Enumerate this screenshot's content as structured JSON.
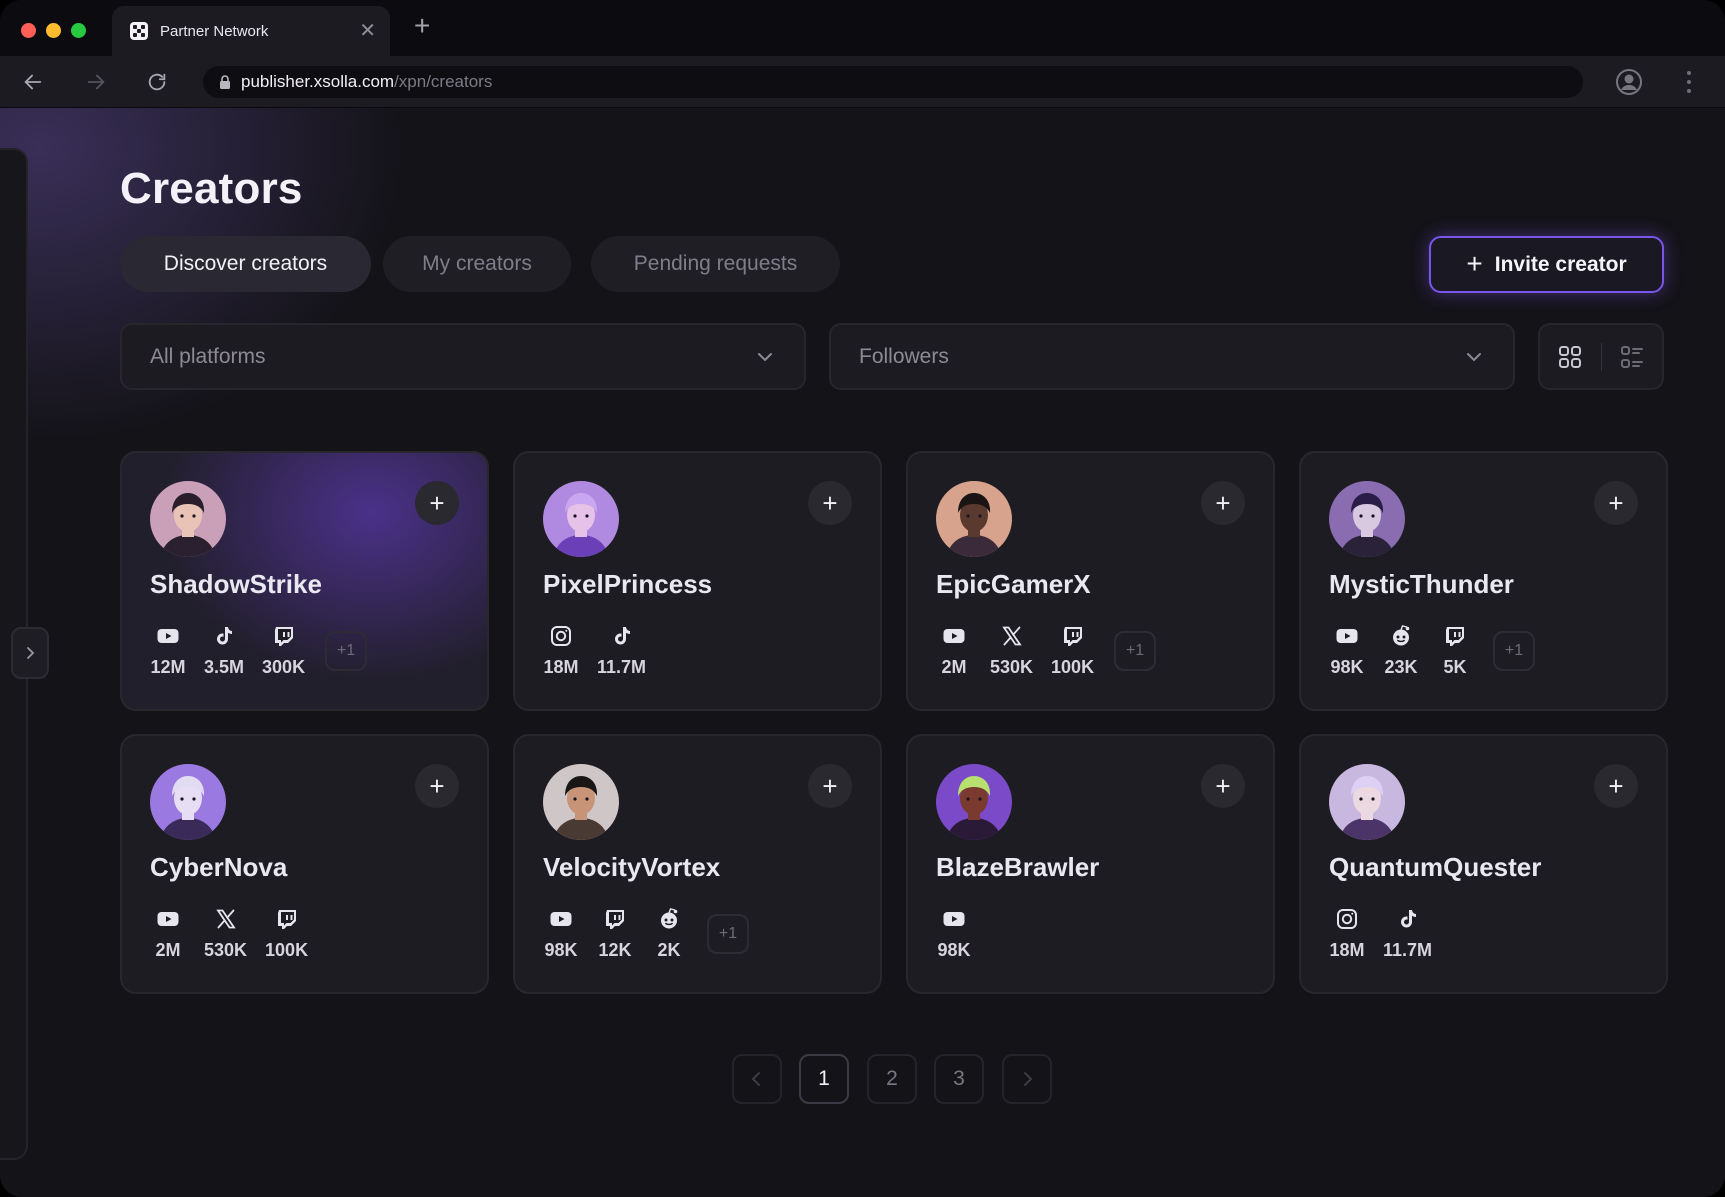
{
  "browser": {
    "tab_title": "Partner Network",
    "url_host": "publisher.xsolla.com",
    "url_path": "/xpn/creators"
  },
  "page": {
    "title": "Creators",
    "tabs": [
      {
        "label": "Discover creators",
        "active": true
      },
      {
        "label": "My creators",
        "active": false
      },
      {
        "label": "Pending requests",
        "active": false
      }
    ],
    "invite_button": "Invite creator",
    "platform_filter": "All platforms",
    "sort_filter": "Followers"
  },
  "creators": [
    {
      "name": "ShadowStrike",
      "stats": [
        {
          "platform": "youtube",
          "value": "12M"
        },
        {
          "platform": "tiktok",
          "value": "3.5M"
        },
        {
          "platform": "twitch",
          "value": "300K"
        }
      ],
      "more": "+1"
    },
    {
      "name": "PixelPrincess",
      "stats": [
        {
          "platform": "instagram",
          "value": "18M"
        },
        {
          "platform": "tiktok",
          "value": "11.7M"
        }
      ],
      "more": ""
    },
    {
      "name": "EpicGamerX",
      "stats": [
        {
          "platform": "youtube",
          "value": "2M"
        },
        {
          "platform": "x",
          "value": "530K"
        },
        {
          "platform": "twitch",
          "value": "100K"
        }
      ],
      "more": "+1"
    },
    {
      "name": "MysticThunder",
      "stats": [
        {
          "platform": "youtube",
          "value": "98K"
        },
        {
          "platform": "reddit",
          "value": "23K"
        },
        {
          "platform": "twitch",
          "value": "5K"
        }
      ],
      "more": "+1"
    },
    {
      "name": "CyberNova",
      "stats": [
        {
          "platform": "youtube",
          "value": "2M"
        },
        {
          "platform": "x",
          "value": "530K"
        },
        {
          "platform": "twitch",
          "value": "100K"
        }
      ],
      "more": ""
    },
    {
      "name": "VelocityVortex",
      "stats": [
        {
          "platform": "youtube",
          "value": "98K"
        },
        {
          "platform": "twitch",
          "value": "12K"
        },
        {
          "platform": "reddit",
          "value": "2K"
        }
      ],
      "more": "+1"
    },
    {
      "name": "BlazeBrawler",
      "stats": [
        {
          "platform": "youtube",
          "value": "98K"
        }
      ],
      "more": ""
    },
    {
      "name": "QuantumQuester",
      "stats": [
        {
          "platform": "instagram",
          "value": "18M"
        },
        {
          "platform": "tiktok",
          "value": "11.7M"
        }
      ],
      "more": ""
    }
  ],
  "pagination": {
    "pages": [
      "1",
      "2",
      "3"
    ],
    "current": "1"
  },
  "colors": {
    "accent": "#7a55ea",
    "background": "#141318",
    "card": "#1d1c22"
  }
}
